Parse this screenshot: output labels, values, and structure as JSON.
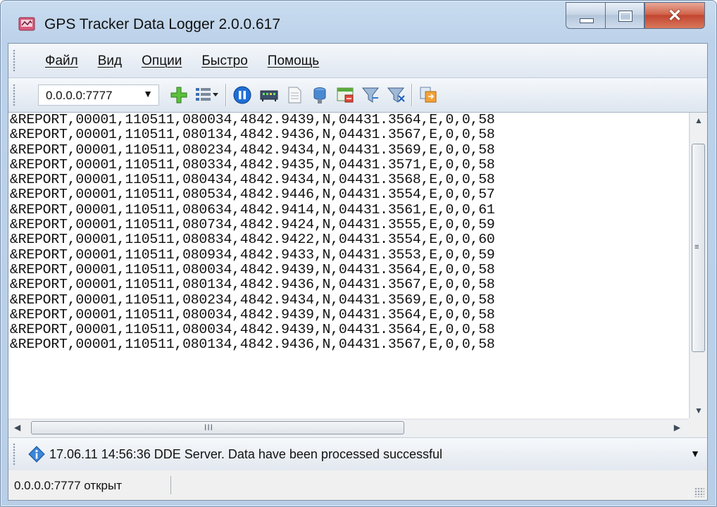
{
  "window": {
    "title": "GPS Tracker Data Logger 2.0.0.617"
  },
  "menu": [
    "Файл",
    "Вид",
    "Опции",
    "Быстро",
    "Помощь"
  ],
  "toolbar": {
    "address_value": "0.0.0.0:7777"
  },
  "log_lines": [
    "&REPORT,00001,110511,080034,4842.9439,N,04431.3564,E,0,0,58",
    "&REPORT,00001,110511,080134,4842.9436,N,04431.3567,E,0,0,58",
    "&REPORT,00001,110511,080234,4842.9434,N,04431.3569,E,0,0,58",
    "&REPORT,00001,110511,080334,4842.9435,N,04431.3571,E,0,0,58",
    "&REPORT,00001,110511,080434,4842.9434,N,04431.3568,E,0,0,58",
    "&REPORT,00001,110511,080534,4842.9446,N,04431.3554,E,0,0,57",
    "&REPORT,00001,110511,080634,4842.9414,N,04431.3561,E,0,0,61",
    "&REPORT,00001,110511,080734,4842.9424,N,04431.3555,E,0,0,59",
    "&REPORT,00001,110511,080834,4842.9422,N,04431.3554,E,0,0,60",
    "&REPORT,00001,110511,080934,4842.9433,N,04431.3553,E,0,0,59",
    "&REPORT,00001,110511,080034,4842.9439,N,04431.3564,E,0,0,58",
    "&REPORT,00001,110511,080134,4842.9436,N,04431.3567,E,0,0,58",
    "&REPORT,00001,110511,080234,4842.9434,N,04431.3569,E,0,0,58",
    "&REPORT,00001,110511,080034,4842.9439,N,04431.3564,E,0,0,58",
    "&REPORT,00001,110511,080034,4842.9439,N,04431.3564,E,0,0,58",
    "&REPORT,00001,110511,080134,4842.9436,N,04431.3567,E,0,0,58"
  ],
  "scroll": {
    "hgrip": "III"
  },
  "message": {
    "text": "17.06.11 14:56:36 DDE Server. Data have been processed successful"
  },
  "status": {
    "text": "0.0.0.0:7777 открыт"
  },
  "icons": {
    "toolbar": [
      "add-icon",
      "list-menu-icon",
      "pause-icon",
      "modem-icon",
      "document-icon",
      "database-icon",
      "window-icon",
      "filter-icon",
      "filter-add-icon",
      "export-icon"
    ],
    "message": "info-icon"
  }
}
